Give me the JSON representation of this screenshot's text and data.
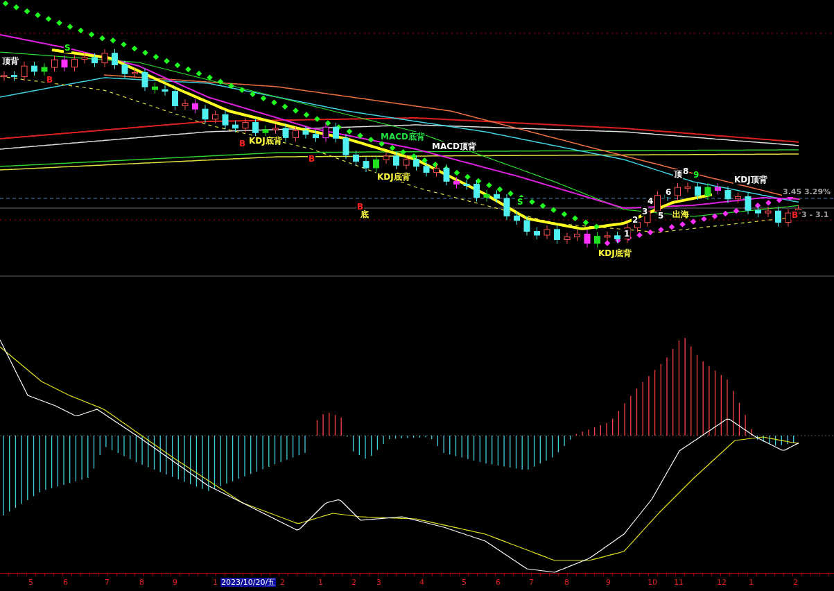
{
  "price_panel": {
    "labels": [
      {
        "text": "顶背",
        "color": "#ffffff"
      },
      {
        "text": "B",
        "color": "#ff2020"
      },
      {
        "text": "S",
        "color": "#20ff20"
      },
      {
        "text": "B",
        "color": "#ff2020"
      },
      {
        "text": "KDJ底背",
        "color": "#ffff40"
      },
      {
        "text": "B",
        "color": "#ff2020"
      },
      {
        "text": "MACD底背",
        "color": "#20e040"
      },
      {
        "text": "MACD顶背",
        "color": "#ffffff"
      },
      {
        "text": "KDJ底背",
        "color": "#ffff40"
      },
      {
        "text": "B",
        "color": "#ff2020"
      },
      {
        "text": "底",
        "color": "#ffff40"
      },
      {
        "text": "S",
        "color": "#20ff20"
      },
      {
        "text": "KDJ底背",
        "color": "#ffff40"
      },
      {
        "text": "顶",
        "color": "#ffffff"
      },
      {
        "text": "8",
        "color": "#ffffff"
      },
      {
        "text": "9",
        "color": "#20ff20"
      },
      {
        "text": "1",
        "color": "#ffffff"
      },
      {
        "text": "2",
        "color": "#ffffff"
      },
      {
        "text": "3",
        "color": "#ffffff"
      },
      {
        "text": "4",
        "color": "#ffffff"
      },
      {
        "text": "5",
        "color": "#ffffff"
      },
      {
        "text": "6",
        "color": "#ffffff"
      },
      {
        "text": "出海",
        "color": "#ffff40"
      },
      {
        "text": "KDJ顶背",
        "color": "#ffffff"
      },
      {
        "text": "3.45 3.29%",
        "color": "#a0a0a0"
      },
      {
        "text": "B",
        "color": "#ff2020"
      },
      {
        "text": "3 - 3.1",
        "color": "#a0a0a0"
      }
    ]
  },
  "time_axis": {
    "labels": [
      {
        "text": "5",
        "selected": false
      },
      {
        "text": "6",
        "selected": false
      },
      {
        "text": "7",
        "selected": false
      },
      {
        "text": "8",
        "selected": false
      },
      {
        "text": "9",
        "selected": false
      },
      {
        "text": "1",
        "selected": false
      },
      {
        "text": "2023/10/20/五",
        "selected": true
      },
      {
        "text": "2",
        "selected": false
      },
      {
        "text": "1",
        "selected": false
      },
      {
        "text": "2",
        "selected": false
      },
      {
        "text": "3",
        "selected": false
      },
      {
        "text": "4",
        "selected": false
      },
      {
        "text": "5",
        "selected": false
      },
      {
        "text": "6",
        "selected": false
      },
      {
        "text": "7",
        "selected": false
      },
      {
        "text": "8",
        "selected": false
      },
      {
        "text": "9",
        "selected": false
      },
      {
        "text": "10",
        "selected": false
      },
      {
        "text": "11",
        "selected": false
      },
      {
        "text": "12",
        "selected": false
      },
      {
        "text": "1",
        "selected": false
      },
      {
        "text": "2",
        "selected": false
      }
    ]
  }
}
